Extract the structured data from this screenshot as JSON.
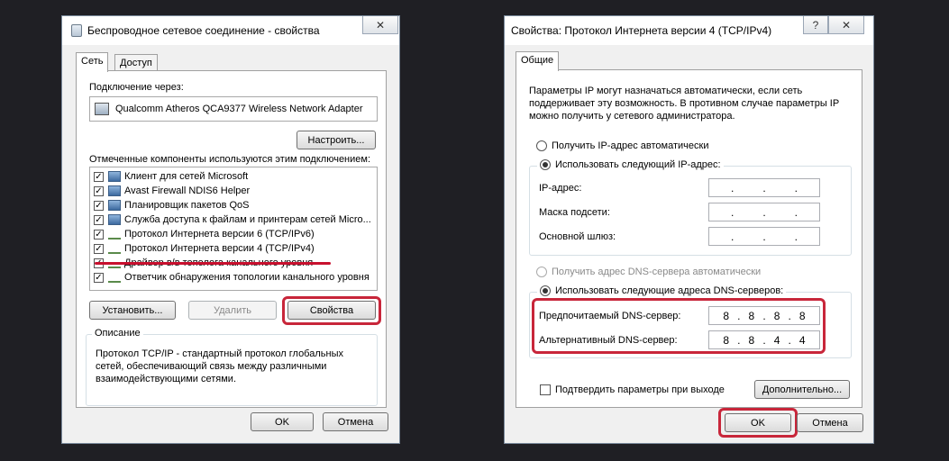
{
  "left_dialog": {
    "title": "Беспроводное сетевое соединение - свойства",
    "close_glyph": "✕",
    "tabs": [
      {
        "label": "Сеть"
      },
      {
        "label": "Доступ"
      }
    ],
    "connect_via_label": "Подключение через:",
    "adapter_name": "Qualcomm Atheros QCA9377 Wireless Network Adapter",
    "configure_label": "Настроить...",
    "components_label": "Отмеченные компоненты используются этим подключением:",
    "components": [
      {
        "label": "Клиент для сетей Microsoft",
        "checked": true,
        "icon": "network-client-icon"
      },
      {
        "label": "Avast Firewall NDIS6 Helper",
        "checked": true,
        "icon": "network-service-icon"
      },
      {
        "label": "Планировщик пакетов QoS",
        "checked": true,
        "icon": "network-service-icon"
      },
      {
        "label": "Служба доступа к файлам и принтерам сетей Micro...",
        "checked": true,
        "icon": "network-service-icon"
      },
      {
        "label": "Протокол Интернета версии 6 (TCP/IPv6)",
        "checked": true,
        "icon": "protocol-icon"
      },
      {
        "label": "Протокол Интернета версии 4 (TCP/IPv4)",
        "checked": true,
        "icon": "protocol-icon"
      },
      {
        "label": "Драйвер в/в тополога канального уровня",
        "checked": true,
        "icon": "protocol-icon"
      },
      {
        "label": "Ответчик обнаружения топологии канального уровня",
        "checked": true,
        "icon": "protocol-icon"
      }
    ],
    "install_label": "Установить...",
    "remove_label": "Удалить",
    "properties_label": "Свойства",
    "description_label": "Описание",
    "description_text": "Протокол TCP/IP - стандартный протокол глобальных сетей, обеспечивающий связь между различными взаимодействующими сетями.",
    "ok_label": "OK",
    "cancel_label": "Отмена"
  },
  "right_dialog": {
    "title": "Свойства: Протокол Интернета версии 4 (TCP/IPv4)",
    "help_glyph": "?",
    "close_glyph": "✕",
    "tab_label": "Общие",
    "intro_text": "Параметры IP могут назначаться автоматически, если сеть поддерживает эту возможность. В противном случае параметры IP можно получить у сетевого администратора.",
    "ip_auto_label": "Получить IP-адрес автоматически",
    "ip_manual_label": "Использовать следующий IP-адрес:",
    "ip_address_label": "IP-адрес:",
    "subnet_mask_label": "Маска подсети:",
    "gateway_label": "Основной шлюз:",
    "dns_auto_label": "Получить адрес DNS-сервера автоматически",
    "dns_manual_label": "Использовать следующие адреса DNS-серверов:",
    "preferred_dns_label": "Предпочитаемый DNS-сервер:",
    "preferred_dns": [
      "8",
      "8",
      "8",
      "8"
    ],
    "alternate_dns_label": "Альтернативный DNS-сервер:",
    "alternate_dns": [
      "8",
      "8",
      "4",
      "4"
    ],
    "validate_label": "Подтвердить параметры при выходе",
    "advanced_label": "Дополнительно...",
    "ok_label": "OK",
    "cancel_label": "Отмена",
    "ip_dot": "."
  }
}
